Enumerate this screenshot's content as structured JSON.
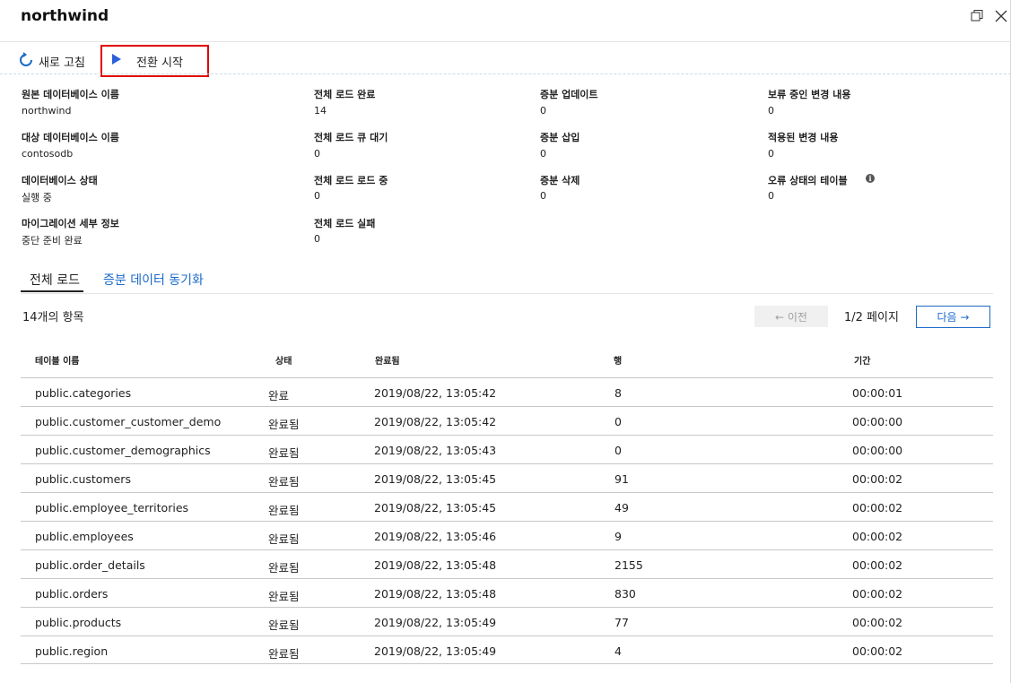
{
  "window": {
    "title": "northwind",
    "restore_icon": "restore-icon",
    "close_icon": "close-icon"
  },
  "toolbar": {
    "refresh_label": "새로 고침",
    "cutover_label": "전환 시작"
  },
  "info": {
    "source_db_label": "원본 데이터베이스 이름",
    "source_db_value": "northwind",
    "target_db_label": "대상 데이터베이스 이름",
    "target_db_value": "contosodb",
    "db_status_label": "데이터베이스 상태",
    "db_status_value": "실행 중",
    "migration_details_label": "마이그레이션 세부 정보",
    "migration_details_value": "중단 준비 완료",
    "full_load_complete_label": "전체 로드 완료",
    "full_load_complete_value": "14",
    "full_load_queued_label": "전체 로드 큐 대기",
    "full_load_queued_value": "0",
    "full_load_loading_label": "전체 로드 로드 중",
    "full_load_loading_value": "0",
    "full_load_failed_label": "전체 로드 실패",
    "full_load_failed_value": "0",
    "incr_updates_label": "증분 업데이트",
    "incr_updates_value": "0",
    "incr_inserts_label": "증분 삽입",
    "incr_inserts_value": "0",
    "incr_deletes_label": "증분 삭제",
    "incr_deletes_value": "0",
    "pending_changes_label": "보류 중인 변경 내용",
    "pending_changes_value": "0",
    "applied_changes_label": "적용된 변경 내용",
    "applied_changes_value": "0",
    "error_tables_label": "오류 상태의 테이블",
    "error_tables_value": "0",
    "info_icon_glyph": "i"
  },
  "tabs": [
    {
      "label": "전체 로드",
      "active": true
    },
    {
      "label": "증분 데이터 동기화",
      "active": false
    }
  ],
  "list": {
    "count_text": "14개의 항목",
    "prev_label": "← 이전",
    "page_text": "1/2 페이지",
    "next_label": "다음 →"
  },
  "table": {
    "headers": [
      "테이블 이름",
      "상태",
      "완료됨",
      "행",
      "기간"
    ],
    "rows": [
      [
        "public.categories",
        "완료",
        "2019/08/22, 13:05:42",
        "8",
        "00:00:01"
      ],
      [
        "public.customer_customer_demo",
        "완료됨",
        "2019/08/22, 13:05:42",
        "0",
        "00:00:00"
      ],
      [
        "public.customer_demographics",
        "완료됨",
        "2019/08/22, 13:05:43",
        "0",
        "00:00:00"
      ],
      [
        "public.customers",
        "완료됨",
        "2019/08/22, 13:05:45",
        "91",
        "00:00:02"
      ],
      [
        "public.employee_territories",
        "완료됨",
        "2019/08/22, 13:05:45",
        "49",
        "00:00:02"
      ],
      [
        "public.employees",
        "완료됨",
        "2019/08/22, 13:05:46",
        "9",
        "00:00:02"
      ],
      [
        "public.order_details",
        "완료됨",
        "2019/08/22, 13:05:48",
        "2155",
        "00:00:02"
      ],
      [
        "public.orders",
        "완료됨",
        "2019/08/22, 13:05:48",
        "830",
        "00:00:02"
      ],
      [
        "public.products",
        "완료됨",
        "2019/08/22, 13:05:49",
        "77",
        "00:00:02"
      ],
      [
        "public.region",
        "완료됨",
        "2019/08/22, 13:05:49",
        "4",
        "00:00:02"
      ]
    ]
  },
  "colors": {
    "accent": "#1b6ac9",
    "highlight_border": "#e00000",
    "play_icon": "#2b5fd9"
  }
}
